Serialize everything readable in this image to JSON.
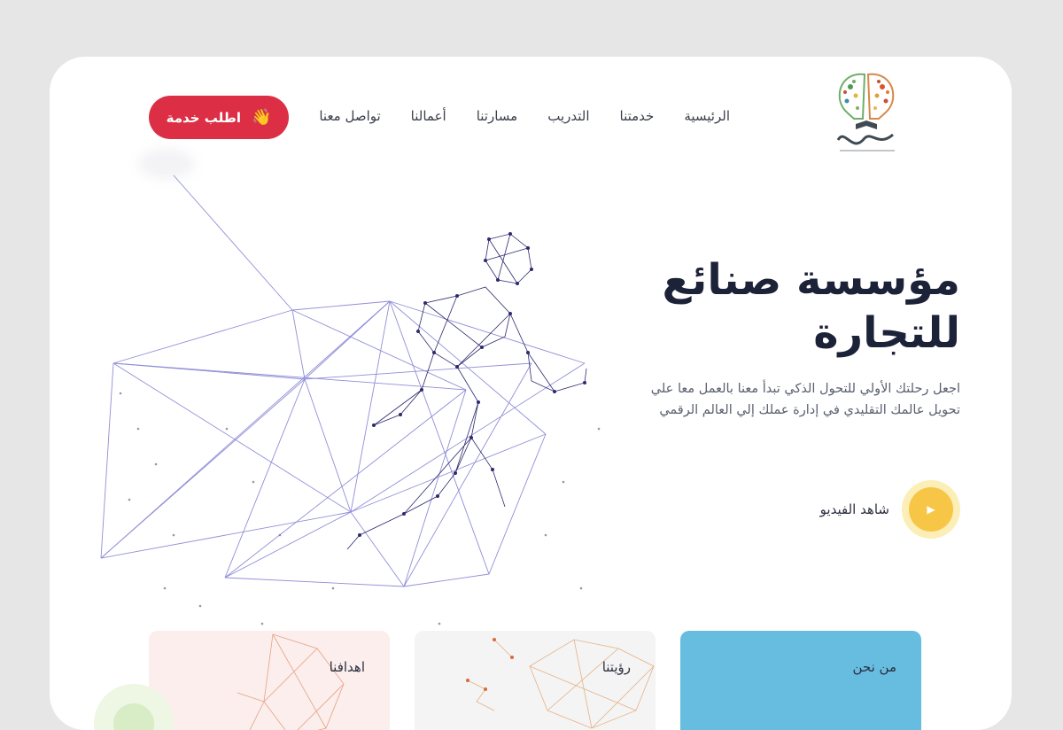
{
  "nav": {
    "cta_label": "اطلب خدمة",
    "items": [
      "الرئيسية",
      "خدمتنا",
      "التدريب",
      "مسارتنا",
      "أعمالنا",
      "تواصل معنا"
    ]
  },
  "hero": {
    "title_line1": "مؤسسة صنائع",
    "title_line2": "للتجارة",
    "desc_line1": "اجعل رحلتك الأولي للتحول الذكي تبدأ معنا بالعمل معا علي",
    "desc_line2": "تحويل عالمك التقليدي في إدارة عملك إلي العالم الرقمي",
    "video_label": "شاهد الفيديو"
  },
  "cards": {
    "about": "من نحن",
    "vision": "رؤيتنا",
    "goals": "اهدافنا"
  },
  "colors": {
    "accent_red": "#dc2f45",
    "accent_yellow": "#f7c646",
    "card_blue": "#66bde0",
    "title_navy": "#1c2338"
  }
}
